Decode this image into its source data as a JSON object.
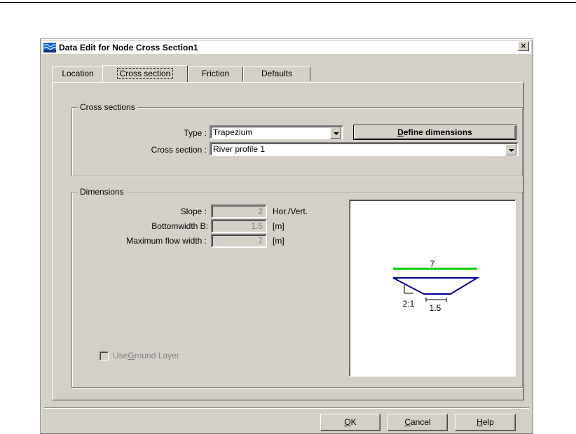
{
  "dialog": {
    "title": "Data Edit for Node Cross Section1",
    "close_label": "×"
  },
  "tabs": [
    {
      "label": "Location"
    },
    {
      "label": "Cross section"
    },
    {
      "label": "Friction"
    },
    {
      "label": "Defaults"
    }
  ],
  "cross_sections": {
    "legend": "Cross sections",
    "type_label": "Type :",
    "type_value": "Trapezium",
    "define_pre": "",
    "define_mn": "D",
    "define_post": "efine dimensions",
    "section_label": "Cross section :",
    "section_value": "River profile 1"
  },
  "dimensions": {
    "legend": "Dimensions",
    "slope_label": "Slope :",
    "slope_value": "2",
    "slope_unit": "Hor./Vert.",
    "bottom_label": "Bottomwidth B:",
    "bottom_value": "1.5",
    "bottom_unit": "[m]",
    "maxflow_label": "Maximum flow width :",
    "maxflow_value": "7",
    "maxflow_unit": "[m]",
    "ground_pre": "Use ",
    "ground_mn": "G",
    "ground_post": "round Layer",
    "ground_checked": false
  },
  "preview": {
    "top_width_label": "7",
    "slope_label": "2:1",
    "bottom_width_label": "1.5",
    "water_color": "#00cc00",
    "profile_color": "#000099"
  },
  "buttons": {
    "ok_mn": "O",
    "ok_post": "K",
    "cancel_mn": "C",
    "cancel_post": "ancel",
    "help_mn": "H",
    "help_post": "elp"
  }
}
